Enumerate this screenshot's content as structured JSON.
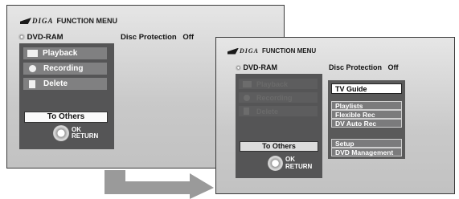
{
  "screen1": {
    "brand": "DIGA",
    "menu_title": "FUNCTION MENU",
    "disc_type": "DVD-RAM",
    "disc_protection_label": "Disc Protection",
    "disc_protection_value": "Off",
    "menu_items": [
      {
        "label": "Playback",
        "icon": "playback-icon"
      },
      {
        "label": "Recording",
        "icon": "clock-icon"
      },
      {
        "label": "Delete",
        "icon": "trash-icon"
      }
    ],
    "to_others": "To Others",
    "ok_label": "OK",
    "return_label": "RETURN"
  },
  "screen2": {
    "brand": "DIGA",
    "menu_title": "FUNCTION MENU",
    "disc_type": "DVD-RAM",
    "disc_protection_label": "Disc Protection",
    "disc_protection_value": "Off",
    "menu_items": [
      {
        "label": "Playback",
        "icon": "playback-icon"
      },
      {
        "label": "Recording",
        "icon": "clock-icon"
      },
      {
        "label": "Delete",
        "icon": "trash-icon"
      }
    ],
    "to_others": "To Others",
    "ok_label": "OK",
    "return_label": "RETURN",
    "submenu": [
      "TV Guide",
      "Playlists",
      "Flexible Rec",
      "DV Auto Rec",
      "Setup",
      "DVD Management"
    ]
  },
  "colors": {
    "panel": "#555556",
    "button": "#808081",
    "arrow": "#9a9a9a"
  }
}
